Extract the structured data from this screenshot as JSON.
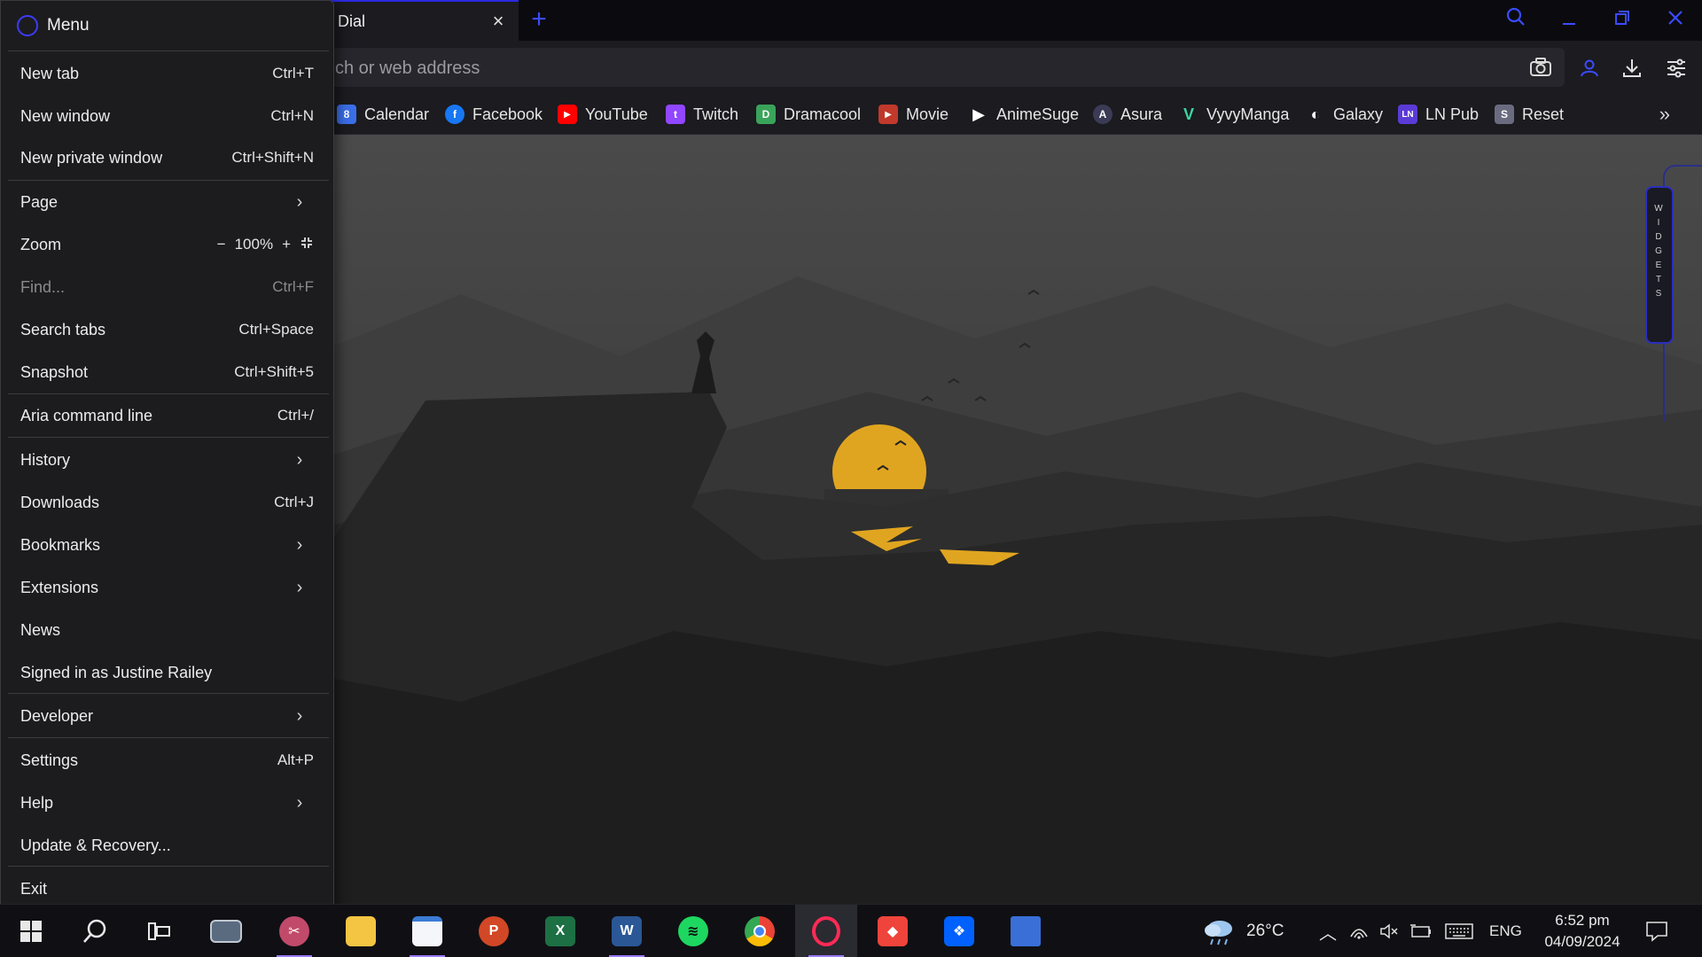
{
  "browser": {
    "tab": {
      "title": "Dial"
    },
    "address": {
      "placeholder": "ch or web address"
    }
  },
  "bookmarks": [
    {
      "label": "Calendar",
      "icon": "calendar-icon",
      "color": "#3b6ee8",
      "glyph": "8"
    },
    {
      "label": "Facebook",
      "icon": "facebook-icon",
      "color": "#1877f2",
      "glyph": "f"
    },
    {
      "label": "YouTube",
      "icon": "youtube-icon",
      "color": "#ff0000",
      "glyph": "▶"
    },
    {
      "label": "Twitch",
      "icon": "twitch-icon",
      "color": "#9146ff",
      "glyph": "t"
    },
    {
      "label": "Dramacool",
      "icon": "dramacool-icon",
      "color": "#3aa35a",
      "glyph": "D"
    },
    {
      "label": "Movie",
      "icon": "movie-icon",
      "color": "#c0392b",
      "glyph": "▶"
    },
    {
      "label": "AnimeSuge",
      "icon": "animesuge-icon",
      "color": "#2a2a2a",
      "glyph": "▶"
    },
    {
      "label": "Asura",
      "icon": "asura-icon",
      "color": "#3b3b55",
      "glyph": "A"
    },
    {
      "label": "VyvyManga",
      "icon": "vyvymanga-icon",
      "color": "#1a8a6a",
      "glyph": "V"
    },
    {
      "label": "Galaxy",
      "icon": "galaxy-icon",
      "color": "#333333",
      "glyph": "◐"
    },
    {
      "label": "LN Pub",
      "icon": "lnpub-icon",
      "color": "#5b3bd6",
      "glyph": "LN"
    },
    {
      "label": "Reset",
      "icon": "reset-icon",
      "color": "#6b6b80",
      "glyph": "S"
    }
  ],
  "widgets": {
    "label": "W I D G E T S"
  },
  "menu": {
    "title": "Menu",
    "items": [
      {
        "label": "New tab",
        "shortcut": "Ctrl+T"
      },
      {
        "label": "New window",
        "shortcut": "Ctrl+N"
      },
      {
        "label": "New private window",
        "shortcut": "Ctrl+Shift+N"
      },
      {
        "label": "Page",
        "shortcut": ""
      },
      {
        "label": "Zoom",
        "shortcut": ""
      },
      {
        "label": "Find...",
        "shortcut": "Ctrl+F"
      },
      {
        "label": "Search tabs",
        "shortcut": "Ctrl+Space"
      },
      {
        "label": "Snapshot",
        "shortcut": "Ctrl+Shift+5"
      },
      {
        "label": "Aria command line",
        "shortcut": "Ctrl+/"
      },
      {
        "label": "History",
        "shortcut": ""
      },
      {
        "label": "Downloads",
        "shortcut": "Ctrl+J"
      },
      {
        "label": "Bookmarks",
        "shortcut": ""
      },
      {
        "label": "Extensions",
        "shortcut": ""
      },
      {
        "label": "News",
        "shortcut": ""
      },
      {
        "label": "Signed in as Justine Railey",
        "shortcut": ""
      },
      {
        "label": "Developer",
        "shortcut": ""
      },
      {
        "label": "Settings",
        "shortcut": "Alt+P"
      },
      {
        "label": "Help",
        "shortcut": ""
      },
      {
        "label": "Update & Recovery...",
        "shortcut": ""
      },
      {
        "label": "Exit",
        "shortcut": ""
      }
    ],
    "zoom": {
      "minus": "−",
      "value": "100%",
      "plus": "+"
    }
  },
  "taskbar": {
    "weather": "26°C",
    "language": "ENG",
    "time": "6:52 pm",
    "date": "04/09/2024"
  },
  "colors": {
    "accent": "#3b4bff",
    "sun": "#e0a520"
  }
}
